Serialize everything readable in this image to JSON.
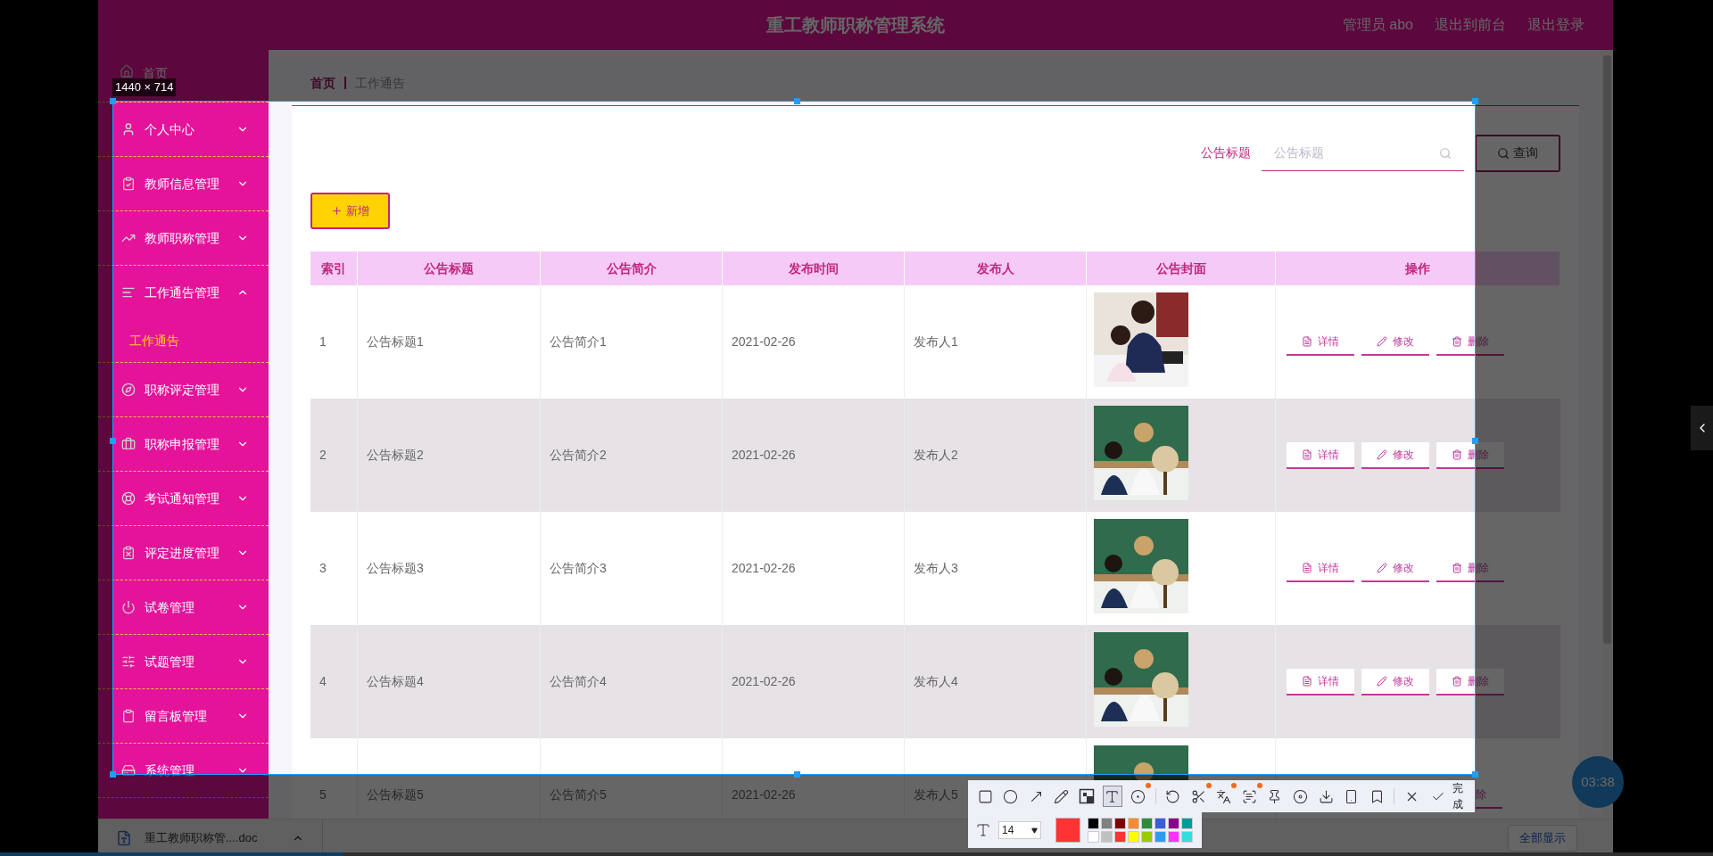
{
  "header": {
    "title": "重工教师职称管理系统",
    "user": "管理员 abo",
    "links": [
      "退出到前台",
      "退出登录"
    ]
  },
  "sidebar": {
    "home": "首页",
    "items": [
      {
        "label": "个人中心",
        "expanded": false
      },
      {
        "label": "教师信息管理",
        "expanded": false
      },
      {
        "label": "教师职称管理",
        "expanded": false
      },
      {
        "label": "工作通告管理",
        "expanded": true,
        "children": [
          {
            "label": "工作通告",
            "selected": true
          }
        ]
      },
      {
        "label": "职称评定管理",
        "expanded": false
      },
      {
        "label": "职称申报管理",
        "expanded": false
      },
      {
        "label": "考试通知管理",
        "expanded": false
      },
      {
        "label": "评定进度管理",
        "expanded": false
      },
      {
        "label": "试卷管理",
        "expanded": false
      },
      {
        "label": "试题管理",
        "expanded": false
      },
      {
        "label": "留言板管理",
        "expanded": false
      },
      {
        "label": "系统管理",
        "expanded": false
      }
    ]
  },
  "breadcrumb": [
    "首页",
    "工作通告"
  ],
  "search": {
    "label": "公告标题",
    "placeholder": "公告标题",
    "button": "查询"
  },
  "add_button": "新增",
  "table": {
    "columns": [
      "索引",
      "公告标题",
      "公告简介",
      "发布时间",
      "发布人",
      "公告封面",
      "操作"
    ],
    "rows": [
      {
        "cells": [
          "1",
          "公告标题1",
          "公告简介1",
          "2021-02-26",
          "发布人1"
        ],
        "cover": {
          "kind": "picture"
        },
        "actions": [
          "详情",
          "修改",
          "删除"
        ]
      },
      {
        "cells": [
          "2",
          "公告标题2",
          "公告简介2",
          "2021-02-26",
          "发布人2"
        ],
        "cover": {
          "kind": "picture"
        },
        "actions": [
          "详情",
          "修改",
          "删除"
        ]
      },
      {
        "cells": [
          "3",
          "公告标题3",
          "公告简介3",
          "2021-02-26",
          "发布人3"
        ],
        "cover": {
          "kind": "picture"
        },
        "actions": [
          "详情",
          "修改",
          "删除"
        ]
      },
      {
        "cells": [
          "4",
          "公告标题4",
          "公告简介4",
          "2021-02-26",
          "发布人4"
        ],
        "cover": {
          "kind": "picture"
        },
        "actions": [
          "详情",
          "修改",
          "删除"
        ]
      },
      {
        "cells": [
          "5",
          "公告标题5",
          "公告简介5",
          "2021-02-26",
          "发布人5"
        ],
        "cover": {
          "kind": "picture"
        },
        "actions": [
          "除"
        ]
      }
    ]
  },
  "download_bar": {
    "file": "重工教师职称管....doc",
    "show_all": "全部显示"
  },
  "timer": "03:38",
  "capture": {
    "size_label": "1440 × 714",
    "tool_groups": [
      [
        {
          "kind": "rectangle",
          "selected": false,
          "badge": false
        },
        {
          "kind": "ellipse",
          "selected": false,
          "badge": false
        },
        {
          "kind": "arrow",
          "selected": false,
          "badge": false
        },
        {
          "kind": "pencil",
          "selected": false,
          "badge": false
        },
        {
          "kind": "mosaic",
          "selected": false,
          "badge": false
        },
        {
          "kind": "text",
          "selected": true,
          "badge": false
        },
        {
          "kind": "number",
          "selected": false,
          "badge": true
        }
      ],
      [
        {
          "kind": "undo",
          "selected": false,
          "badge": false
        },
        {
          "kind": "scissors",
          "selected": false,
          "badge": true
        },
        {
          "kind": "translate",
          "selected": false,
          "badge": true
        },
        {
          "kind": "ocr",
          "selected": false,
          "badge": true
        },
        {
          "kind": "pin",
          "selected": false,
          "badge": false
        },
        {
          "kind": "record",
          "selected": false,
          "badge": false
        },
        {
          "kind": "download",
          "selected": false,
          "badge": false
        },
        {
          "kind": "phone",
          "selected": false,
          "badge": false
        },
        {
          "kind": "bookmark",
          "selected": false,
          "badge": false
        }
      ],
      [
        {
          "kind": "close",
          "selected": false,
          "badge": false
        }
      ]
    ],
    "done": "完成",
    "font_size": "14",
    "current_swatch": {
      "color": "#ff3333"
    },
    "palette": [
      {
        "color": "#000000"
      },
      {
        "color": "#808080"
      },
      {
        "color": "#800000"
      },
      {
        "color": "#f28c38"
      },
      {
        "color": "#2e8b3a"
      },
      {
        "color": "#3c5fd6"
      },
      {
        "color": "#8b008b"
      },
      {
        "color": "#009a9a"
      },
      {
        "color": "#ffffff"
      },
      {
        "color": "#c0c0c0"
      },
      {
        "color": "#ff3333"
      },
      {
        "color": "#ffff00"
      },
      {
        "color": "#99cc00"
      },
      {
        "color": "#3399ee"
      },
      {
        "color": "#ff33ff"
      },
      {
        "color": "#33dddd"
      }
    ]
  },
  "video_progress": {
    "level": 0.2
  }
}
